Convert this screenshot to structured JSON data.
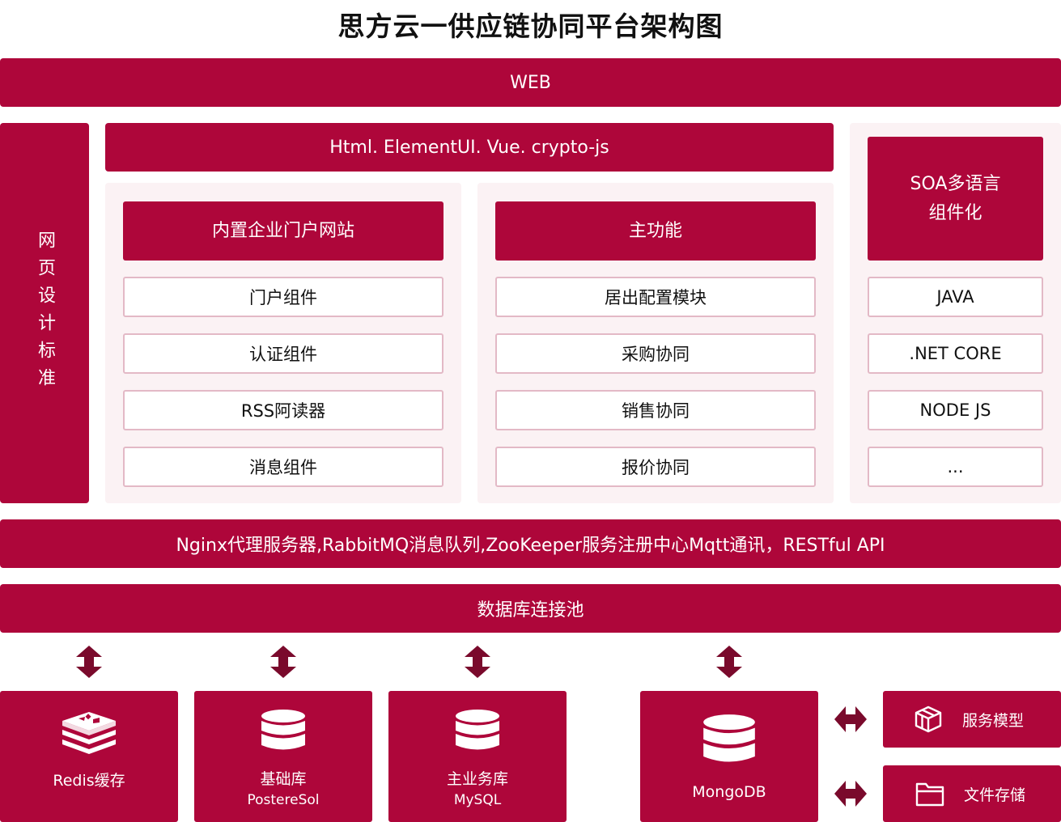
{
  "title": "思方云一供应链协同平台架构图",
  "web": "WEB",
  "side_label": "网页设计标准",
  "frontend": "Html.  ElementUI. Vue.  crypto-js",
  "col_portal": {
    "header": "内置企业门户网站",
    "items": [
      "门户组件",
      "认证组件",
      "RSS阿读器",
      "消息组件"
    ]
  },
  "col_main": {
    "header": "主功能",
    "items": [
      "居出配置模块",
      "采购协同",
      "销售协同",
      "报价协同"
    ]
  },
  "col_soa": {
    "header_line1": "SOA多语言",
    "header_line2": "组件化",
    "items": [
      "JAVA",
      ".NET CORE",
      "NODE JS",
      "..."
    ]
  },
  "middleware": "Nginx代理服务器,RabbitMQ消息队列,ZooKeeper服务注册中心Mqtt通讯，RESTful API",
  "pool": "数据库连接池",
  "stores": {
    "redis": {
      "label": "Redis缓存",
      "icon": "redis-icon"
    },
    "base": {
      "label": "基础库",
      "sub": "PostereSol",
      "icon": "database-icon"
    },
    "biz": {
      "label": "主业务库",
      "sub": "MySQL",
      "icon": "database-icon"
    },
    "mongo": {
      "label": "MongoDB",
      "icon": "database-icon"
    }
  },
  "side_cards": {
    "service": {
      "label": "服务模型",
      "icon": "cube-icon"
    },
    "files": {
      "label": "文件存储",
      "icon": "folder-icon"
    }
  },
  "colors": {
    "brand": "#ae063a",
    "panel": "#fbf2f4",
    "border": "#e3b9c6",
    "arrow": "#7a0a2c"
  }
}
